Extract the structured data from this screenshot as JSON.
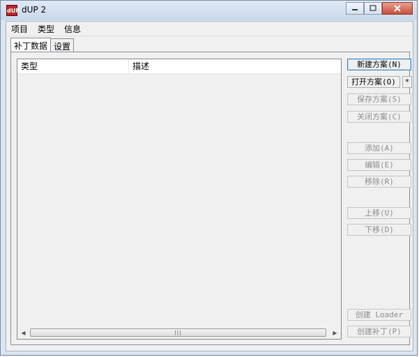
{
  "window": {
    "title": "dUP 2",
    "app_icon_text": "dUP"
  },
  "menu": [
    "项目",
    "类型",
    "信息"
  ],
  "tabs": [
    "补丁数据",
    "设置"
  ],
  "list": {
    "columns": [
      "类型",
      "描述"
    ]
  },
  "buttons": {
    "new_scheme": "新建方案(N)",
    "open_scheme": "打开方案(O)",
    "star": "*",
    "save_scheme": "保存方案(S)",
    "close_scheme": "关闭方案(C)",
    "add": "添加(A)",
    "edit": "编辑(E)",
    "remove": "移除(R)",
    "move_up": "上移(U)",
    "move_down": "下移(D)",
    "create_loader": "创建 Loader",
    "create_patch": "创建补丁(P)"
  },
  "icons": {
    "scroll_left": "scroll-left-icon",
    "scroll_right": "scroll-right-icon"
  }
}
